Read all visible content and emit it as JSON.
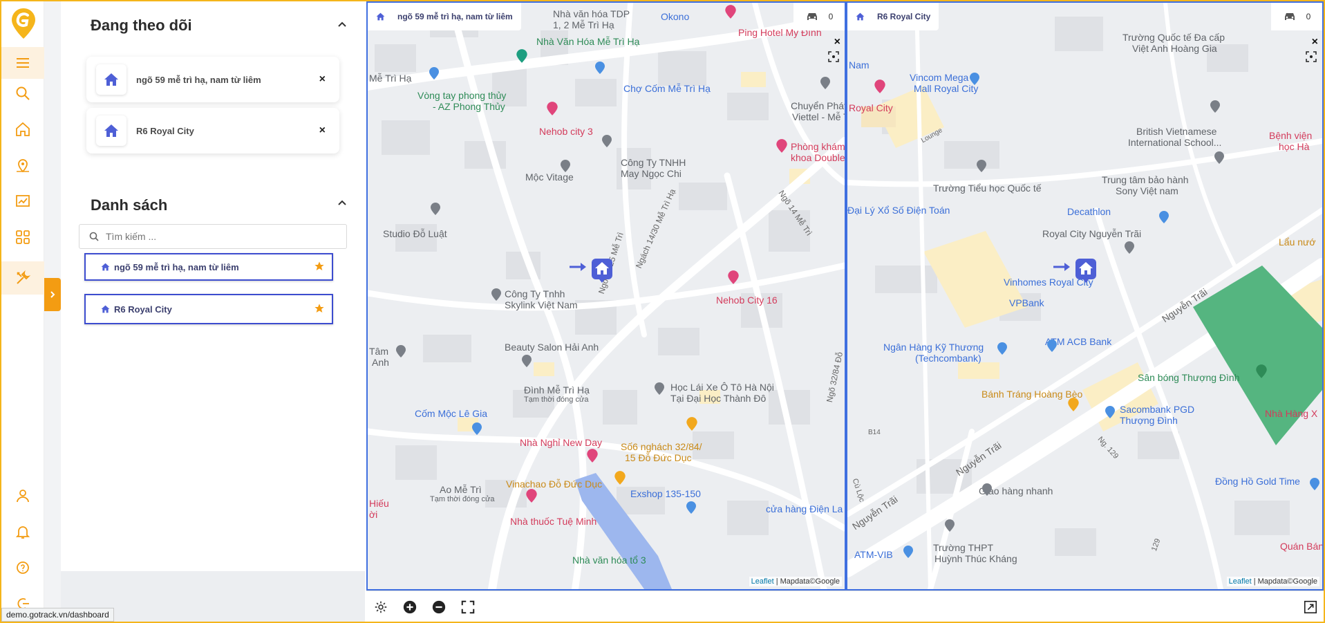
{
  "app": {
    "accent_color": "#f39c12",
    "map_border_color": "#3f6fe0"
  },
  "rail": {
    "items": [
      {
        "icon": "menu-icon",
        "active": true
      },
      {
        "icon": "search-icon"
      },
      {
        "icon": "home-icon"
      },
      {
        "icon": "map-pin-icon"
      },
      {
        "icon": "chart-icon"
      },
      {
        "icon": "apps-icon"
      },
      {
        "icon": "tools-icon",
        "active": true
      },
      {
        "icon": "user-icon"
      },
      {
        "icon": "bell-icon"
      },
      {
        "icon": "help-icon"
      },
      {
        "icon": "logout-icon"
      }
    ]
  },
  "following": {
    "title": "Đang theo dõi",
    "items": [
      {
        "label": "ngõ 59 mễ trì hạ, nam từ liêm"
      },
      {
        "label": "R6 Royal City"
      }
    ],
    "close_symbol": "×"
  },
  "list": {
    "title": "Danh sách",
    "search_placeholder": "Tìm kiếm ...",
    "items": [
      {
        "label": "ngõ 59 mễ trì hạ, nam từ liêm",
        "starred": true
      },
      {
        "label": "R6 Royal City",
        "starred": true
      }
    ]
  },
  "maps": [
    {
      "title": "ngõ 59 mễ trì hạ, nam từ liêm",
      "vehicle_count": "0",
      "close": "×",
      "attribution_link": "Leaflet",
      "attribution_text": "| Mapdata©Google",
      "labels": {
        "l1": "Nhà văn hóa TDP",
        "l1b": "1, 2 Mễ Trì Hạ",
        "l2": "Okono",
        "l3": "Ping Hotel Mỹ Đình",
        "l4": "Nhà Văn Hóa Mễ Trì Hạ",
        "l5": "Mễ Trì Hạ",
        "l6": "Chợ Cốm Mễ Trì Hạ",
        "l7": "Vòng tay phong thủy",
        "l7b": "- AZ Phong Thủy",
        "l8": "Chuyển Phát Nha",
        "l8b": "Viettel - Mễ Trì",
        "l9": "Nehob city 3",
        "l10": "Công Ty TNHH",
        "l10b": "May Ngọc Chi",
        "l11": "Phòng khám",
        "l11b": "khoa Double",
        "l12": "Mộc Vitage",
        "l13": "Studio Đỗ Luật",
        "l14": "Ngõ 14 Mễ Trì",
        "l15": "Ngách 14/30 Mễ Trì Hạ",
        "l16": "Ngõ 93/25 Mễ Trì",
        "l17": "Nehob City 16",
        "l18": "Công Ty Tnhh",
        "l18b": "Skylink Việt Nam",
        "l19": "Beauty Salon Hải Anh",
        "l20": "Tâm",
        "l20b": "Anh",
        "l21": "Đình Mễ Trì Hạ",
        "l21b": "Tạm thời đóng cửa",
        "l22": "Học Lái Xe Ô Tô Hà Nội",
        "l22b": "Tại Đại Học Thành Đô",
        "l23": "Cốm Mộc Lê Gia",
        "l24": "Ngõ 32/84 Đỗ",
        "l25": "Nhà Nghỉ New Day",
        "l26": "Số6 nghách 32/84/",
        "l26b": "15 Đỗ Đức Dục",
        "l27": "Ao Mễ Trì",
        "l27b": "Tạm thời đóng cửa",
        "l28": "Vinachao Đỗ Đức Dục",
        "l29": "Exshop 135-150",
        "l30": "Hiếu",
        "l30b": "ời",
        "l31": "Nhà thuốc Tuệ Minh",
        "l32": "cửa hàng Điện La",
        "l33": "Nhà văn hóa tổ 3"
      }
    },
    {
      "title": "R6 Royal City",
      "vehicle_count": "0",
      "close": "×",
      "attribution_link": "Leaflet",
      "attribution_text": "| Mapdata©Google",
      "labels": {
        "m1": "Trường Quốc tế Đa cấp",
        "m1b": "Việt Anh Hoàng Gia",
        "m2": "Nam",
        "m3": "Vincom Mega",
        "m3b": "Mall Royal City",
        "m4": "Royal City",
        "m5": "Lounge",
        "m6": "British Vietnamese",
        "m6b": "International School...",
        "m7": "Bệnh viện",
        "m7b": "học Hà",
        "m8": "Trường Tiểu học Quốc tế",
        "m9": "Trung tâm bảo hành",
        "m9b": "Sony Việt nam",
        "m10": "Đại Lý Xổ Số Điện Toán",
        "m11": "Decathlon",
        "m12": "Royal City Nguyễn Trãi",
        "m13": "Lẩu nướ",
        "m14": "Vinhomes Royal City",
        "m15": "VPBank",
        "m16": "Nguyễn Trãi",
        "m17": "Ngân Hàng Kỹ Thương",
        "m17b": "(Techcombank)",
        "m18": "ATM ACB Bank",
        "m19": "Sân bóng Thượng Đình",
        "m20": "Bánh Tráng Hoàng Bèo",
        "m21": "Sacombank PGD",
        "m21b": "Thượng Đình",
        "m22": "Nhà Hàng X",
        "m23": "B14",
        "m24": "Nguyễn Trãi",
        "m25": "Ng. 129",
        "m26": "Giao hàng nhanh",
        "m27": "Đồng Hồ Gold Time",
        "m28": "Cù Lộc",
        "m29": "Nguyễn Trãi",
        "m30": "Trường THPT",
        "m30b": "Huỳnh Thúc Kháng",
        "m31": "ATM-VIB",
        "m32": "Quán Bánh",
        "m33": "129"
      }
    }
  ],
  "status_url": "demo.gotrack.vn/dashboard"
}
